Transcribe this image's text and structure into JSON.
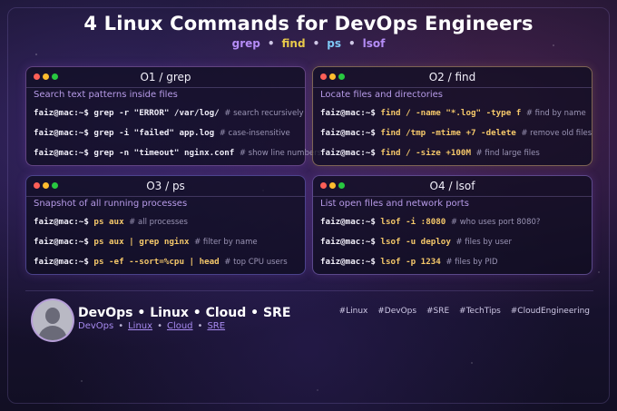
{
  "header": {
    "title": "4 Linux Commands for DevOps Engineers",
    "keywords": [
      "grep",
      "find",
      "ps",
      "lsof"
    ],
    "separator": "•"
  },
  "cards": [
    {
      "title": "O1 / grep",
      "description": "Search text patterns inside files",
      "lines": [
        {
          "prompt": "faiz@mac:~",
          "sign": "$",
          "code": "grep -r \"ERROR\" /var/log/",
          "comment": "# search recursively"
        },
        {
          "prompt": "faiz@mac:~",
          "sign": "$",
          "code": "grep -i \"failed\" app.log",
          "comment": "# case-insensitive"
        },
        {
          "prompt": "faiz@mac:~",
          "sign": "$",
          "code": "grep -n \"timeout\" nginx.conf",
          "comment": "# show line numbers"
        }
      ]
    },
    {
      "title": "O2 / find",
      "description": "Locate files and directories",
      "lines": [
        {
          "prompt": "faiz@mac:~",
          "sign": "$",
          "code": "find / -name \"*.log\" -type f",
          "comment": "# find by name"
        },
        {
          "prompt": "faiz@mac:~",
          "sign": "$",
          "code": "find /tmp -mtime +7 -delete",
          "comment": "# remove old files"
        },
        {
          "prompt": "faiz@mac:~",
          "sign": "$",
          "code": "find / -size +100M",
          "comment": "# find large files"
        }
      ]
    },
    {
      "title": "O3 / ps",
      "description": "Snapshot of all running processes",
      "lines": [
        {
          "prompt": "faiz@mac:~",
          "sign": "$",
          "code": "ps aux",
          "comment": "# all processes"
        },
        {
          "prompt": "faiz@mac:~",
          "sign": "$",
          "code": "ps aux | grep nginx",
          "comment": "# filter by name"
        },
        {
          "prompt": "faiz@mac:~",
          "sign": "$",
          "code": "ps -ef --sort=%cpu | head",
          "comment": "# top CPU users"
        }
      ]
    },
    {
      "title": "O4 / lsof",
      "description": "List open files and network ports",
      "lines": [
        {
          "prompt": "faiz@mac:~",
          "sign": "$",
          "code": "lsof -i :8080",
          "comment": "# who uses port 8080?"
        },
        {
          "prompt": "faiz@mac:~",
          "sign": "$",
          "code": "lsof -u deploy",
          "comment": "# files by user"
        },
        {
          "prompt": "faiz@mac:~",
          "sign": "$",
          "code": "lsof -p 1234",
          "comment": "# files by PID"
        }
      ]
    }
  ],
  "footer": {
    "title": "DevOps • Linux • Cloud • SRE",
    "links": [
      "DevOps",
      "Linux",
      "Cloud",
      "SRE"
    ],
    "link_separator": "•",
    "hashtags": [
      "#Linux",
      "#DevOps",
      "#SRE",
      "#TechTips",
      "#CloudEngineering"
    ]
  },
  "colors": {
    "accent_purple": "#b48cf5",
    "accent_gold": "#f5c86a",
    "accent_blue": "#7ec8f5",
    "window_close": "#ff5f57",
    "window_minimize": "#febc2e",
    "window_maximize": "#28c840"
  }
}
